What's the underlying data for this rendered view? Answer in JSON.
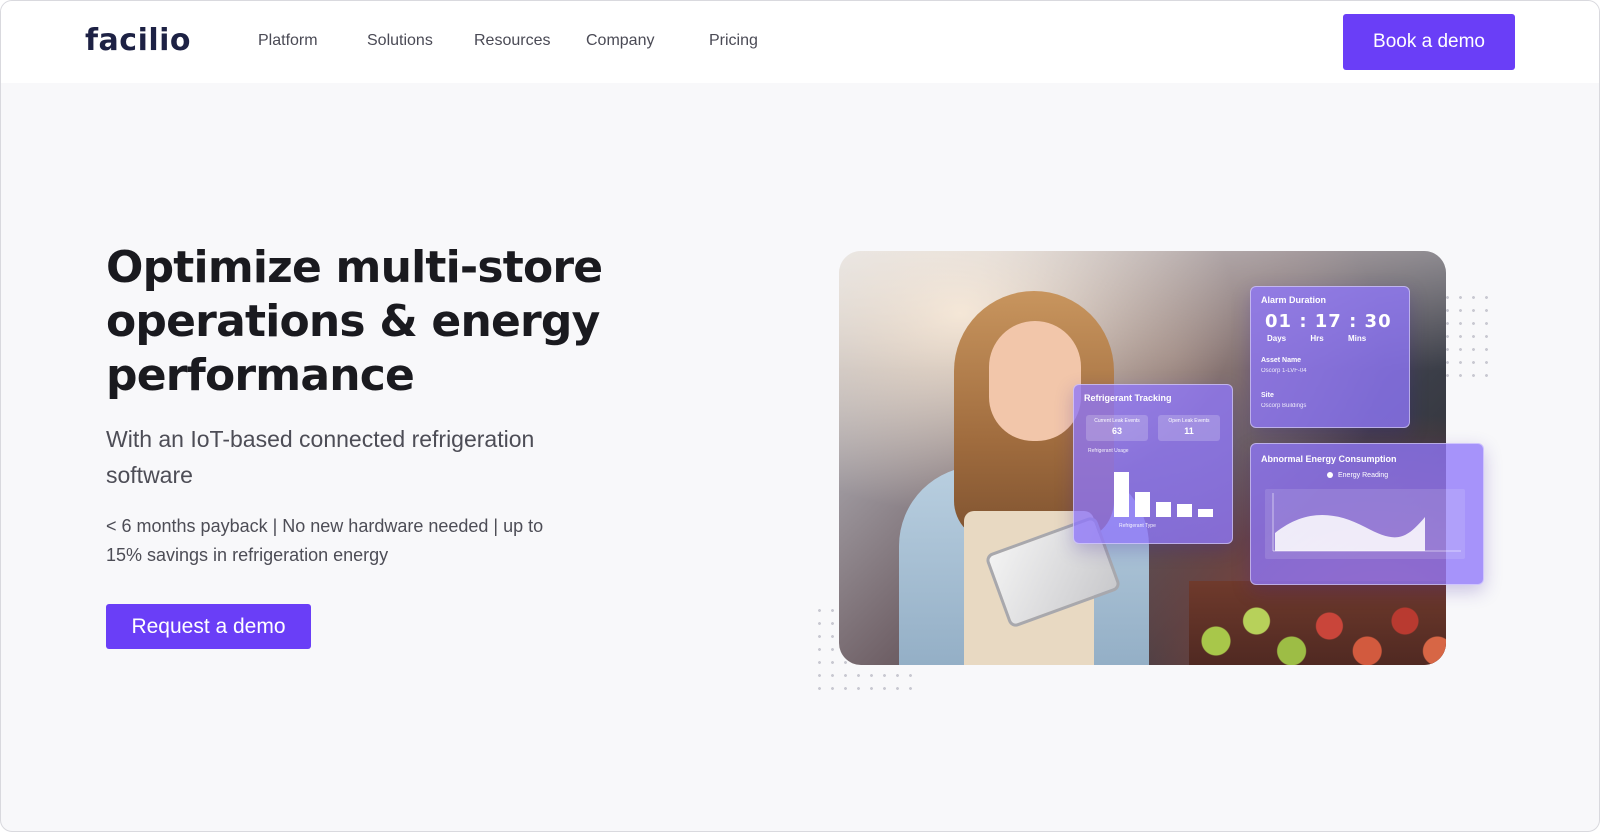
{
  "nav": {
    "logo": "facilio",
    "items": [
      "Platform",
      "Solutions",
      "Resources",
      "Company",
      "Pricing"
    ],
    "cta": "Book a demo"
  },
  "hero": {
    "title": "Optimize multi-store operations & energy performance",
    "subtitle": "With an IoT-based connected refrigeration software",
    "note": "< 6 months payback | No new hardware needed | up to 15% savings in refrigeration energy",
    "cta": "Request a demo"
  },
  "cards": {
    "alarm": {
      "title": "Alarm Duration",
      "time": "01 : 17 : 30",
      "units": [
        "Days",
        "Hrs",
        "Mins"
      ],
      "asset_label": "Asset Name",
      "asset_value": "Oscorp 1-LVF-04",
      "site_label": "Site",
      "site_value": "Oscorp Buildings"
    },
    "refrigerant": {
      "title": "Refrigerant Tracking",
      "left_label": "Current Leak Events",
      "left_value": "63",
      "right_label": "Open Leak Events",
      "right_value": "11",
      "sub_label": "Refrigerant Usage",
      "axis_label": "Refrigerant Type",
      "bars": [
        0.9,
        0.5,
        0.3,
        0.25,
        0.15
      ]
    },
    "energy": {
      "title": "Abnormal Energy Consumption",
      "legend": "Energy Reading"
    }
  },
  "colors": {
    "brand": "#6a3ef7",
    "logo": "#1d2144"
  }
}
